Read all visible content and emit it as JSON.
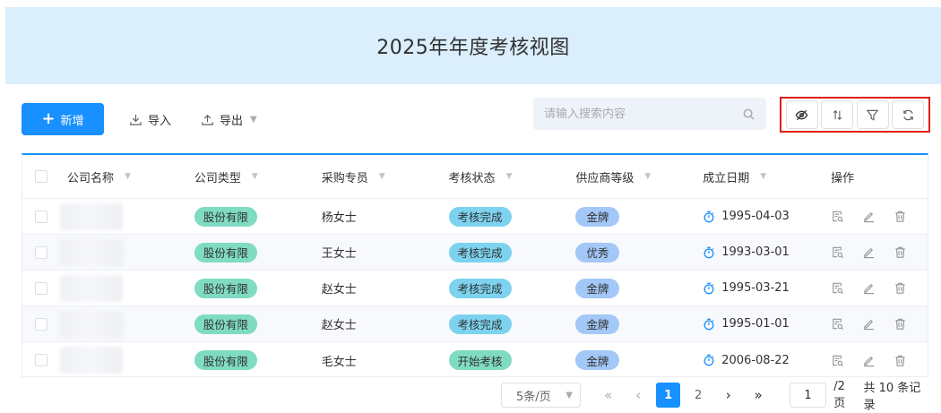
{
  "header": {
    "title": "2025年年度考核视图"
  },
  "toolbar": {
    "new_label": "新增",
    "import_label": "导入",
    "export_label": "导出",
    "search_placeholder": "请输入搜索内容",
    "icons": [
      "eye-slash-icon",
      "sort-icon",
      "filter-icon",
      "refresh-icon"
    ]
  },
  "table": {
    "columns": [
      "公司名称",
      "公司类型",
      "采购专员",
      "考核状态",
      "供应商等级",
      "成立日期",
      "操作"
    ],
    "rows": [
      {
        "type": "股份有限",
        "buyer": "杨女士",
        "status": "考核完成",
        "level": "金牌",
        "date": "1995-04-03"
      },
      {
        "type": "股份有限",
        "buyer": "王女士",
        "status": "考核完成",
        "level": "优秀",
        "date": "1993-03-01"
      },
      {
        "type": "股份有限",
        "buyer": "赵女士",
        "status": "考核完成",
        "level": "金牌",
        "date": "1995-03-21"
      },
      {
        "type": "股份有限",
        "buyer": "赵女士",
        "status": "考核完成",
        "level": "金牌",
        "date": "1995-01-01"
      },
      {
        "type": "股份有限",
        "buyer": "毛女士",
        "status": "开始考核",
        "level": "金牌",
        "date": "2006-08-22"
      }
    ]
  },
  "pagination": {
    "page_size": "5条/页",
    "pages": [
      "1",
      "2"
    ],
    "current": "1",
    "goto_value": "1",
    "total_pages": "/2页",
    "total_records": "共 10 条记录"
  },
  "colors": {
    "accent": "#1890ff",
    "header_bg": "#dbeefb",
    "tag_green": "#7fdbc2",
    "tag_blue": "#7dd3ef",
    "tag_level": "#a3c8f7",
    "highlight_border": "#e0201a"
  }
}
